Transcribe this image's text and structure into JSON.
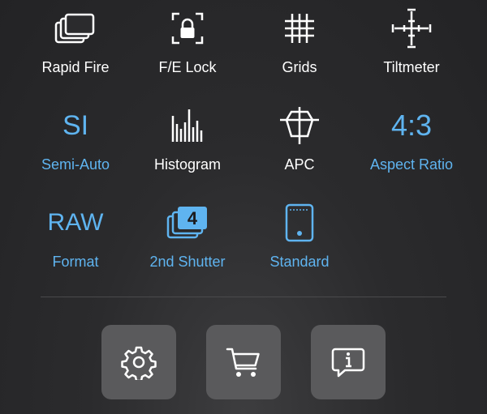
{
  "colors": {
    "accent": "#5fb4f0",
    "text": "#ffffff",
    "button_bg": "#5a5a5c",
    "divider": "#4a4a4c"
  },
  "tiles": [
    {
      "label": "Rapid Fire",
      "icon": "rapid-fire-icon",
      "active": false
    },
    {
      "label": "F/E Lock",
      "icon": "lock-icon",
      "active": false
    },
    {
      "label": "Grids",
      "icon": "grid-icon",
      "active": false
    },
    {
      "label": "Tiltmeter",
      "icon": "tiltmeter-icon",
      "active": false
    },
    {
      "label": "Semi-Auto",
      "icon": "si-text-icon",
      "icon_text": "SI",
      "active": true
    },
    {
      "label": "Histogram",
      "icon": "histogram-icon",
      "active": false
    },
    {
      "label": "APC",
      "icon": "apc-icon",
      "active": false
    },
    {
      "label": "Aspect Ratio",
      "icon": "aspect-ratio-text-icon",
      "icon_text": "4:3",
      "active": true
    },
    {
      "label": "Format",
      "icon": "raw-text-icon",
      "icon_text": "RAW",
      "active": true
    },
    {
      "label": "2nd Shutter",
      "icon": "second-shutter-icon",
      "icon_text": "4",
      "active": true
    },
    {
      "label": "Standard",
      "icon": "phone-standard-icon",
      "active": true
    }
  ],
  "bottom_buttons": [
    {
      "name": "settings",
      "icon": "gear-icon"
    },
    {
      "name": "store",
      "icon": "cart-icon"
    },
    {
      "name": "info",
      "icon": "info-bubble-icon"
    }
  ]
}
